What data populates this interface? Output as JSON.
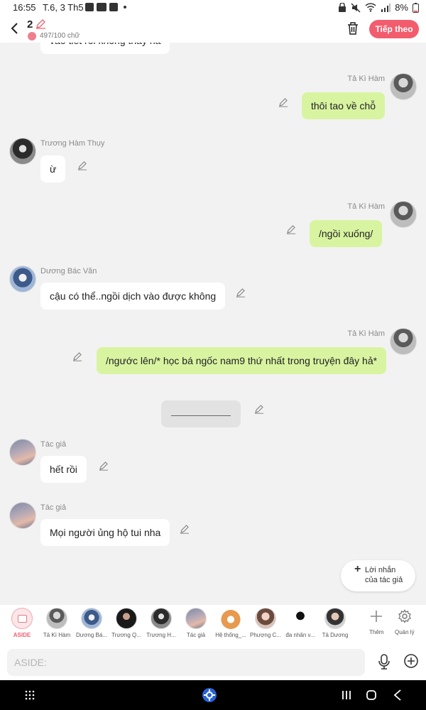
{
  "status": {
    "time": "16:55",
    "date": "T.6, 3 Th5",
    "battery": "8%"
  },
  "header": {
    "chapter": "2",
    "word_count": "497/100 chữ",
    "next_label": "Tiếp theo"
  },
  "messages": [
    {
      "text": "vào tiết rồi không thấy hả"
    },
    {
      "name": "Tả Kì Hàm",
      "text": "thôi tao về chỗ"
    },
    {
      "name": "Trương Hàm Thụy",
      "text": "ừ"
    },
    {
      "name": "Tả Kì Hàm",
      "text": "/ngồi xuống/"
    },
    {
      "name": "Dương Bác Văn",
      "text": "cậu có thể..ngồi dịch vào được không"
    },
    {
      "name": "Tả Kì Hàm",
      "text": "/ngước lên/* học bá ngốc nam9 thứ nhất trong truyện đây hả*"
    },
    {
      "name": "Tác giả",
      "text": "hết rồi"
    },
    {
      "name": "Tác giả",
      "text": "Mọi người ủng hộ tui nha"
    }
  ],
  "author_note": {
    "line1": "Lời nhắn",
    "line2": "của tác giả"
  },
  "characters": [
    {
      "label": "ASIDE"
    },
    {
      "label": "Tả Kì Hàm"
    },
    {
      "label": "Dương Bá..."
    },
    {
      "label": "Trương Q..."
    },
    {
      "label": "Trương H..."
    },
    {
      "label": "Tác giả"
    },
    {
      "label": "Hệ thống_..."
    },
    {
      "label": "Phượng C..."
    },
    {
      "label": "đa nhân v..."
    },
    {
      "label": "Tả Dương"
    }
  ],
  "tools": {
    "add_label": "Thêm",
    "manage_label": "Quản lý"
  },
  "input": {
    "placeholder": "ASIDE:"
  },
  "colors": {
    "accent": "#f25d6e",
    "bubble_green": "#d9f4a1",
    "bubble_white": "#ffffff",
    "background": "#f2f2f2"
  }
}
